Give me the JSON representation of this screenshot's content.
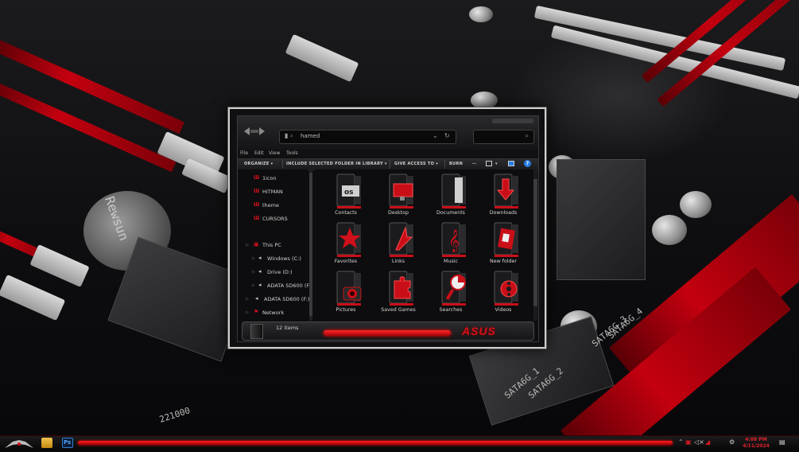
{
  "address_bar": {
    "path": "hamed"
  },
  "menu": [
    "File",
    "Edit",
    "View",
    "Tools"
  ],
  "toolbar": {
    "organize": "ORGANIZE",
    "include_in_library": "INCLUDE SELECTED FOLDER IN LIBRARY",
    "give_access_to": "GIVE ACCESS TO",
    "burn": "BURN"
  },
  "nav": {
    "favorites": [
      "1icon",
      "HITMAN",
      "theme",
      "CURSORS"
    ],
    "this_pc": "This PC",
    "drives": [
      "Windows (C:)",
      "Drive (D:)",
      "ADATA SD600 (F:)",
      "ADATA SD600 (F:)"
    ],
    "network": "Network"
  },
  "folders": [
    {
      "label": "Contacts",
      "icon": "contacts-folder-icon"
    },
    {
      "label": "Desktop",
      "icon": "desktop-folder-icon"
    },
    {
      "label": "Documents",
      "icon": "documents-folder-icon"
    },
    {
      "label": "Downloads",
      "icon": "downloads-folder-icon"
    },
    {
      "label": "Favorites",
      "icon": "favorites-folder-icon"
    },
    {
      "label": "Links",
      "icon": "links-folder-icon"
    },
    {
      "label": "Music",
      "icon": "music-folder-icon"
    },
    {
      "label": "New folder",
      "icon": "new-folder-icon"
    },
    {
      "label": "Pictures",
      "icon": "pictures-folder-icon"
    },
    {
      "label": "Saved Games",
      "icon": "saved-games-folder-icon"
    },
    {
      "label": "Searches",
      "icon": "searches-folder-icon"
    },
    {
      "label": "Videos",
      "icon": "videos-folder-icon"
    }
  ],
  "details": {
    "item_count": "12 items",
    "brand": "ASUS"
  },
  "taskbar": {
    "time": "4:08 PM",
    "date": "4/11/2024",
    "ps_label": "Ps"
  },
  "wallpaper": {
    "text_1": "Rewsun",
    "text_2": "SATA6G_1",
    "text_3": "SATA6G_2",
    "text_4": "SATA6G_3",
    "text_5": "SATA6G_4",
    "text_6": "221000"
  },
  "colors": {
    "accent": "#d80f18",
    "background": "#0d0d0f"
  }
}
